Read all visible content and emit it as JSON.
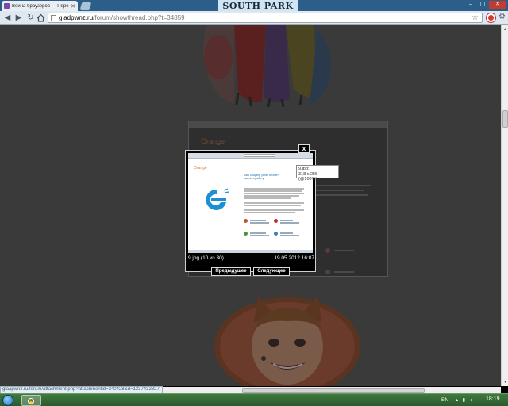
{
  "browser": {
    "tab_title": "Война браузеров — Пере",
    "tab_close": "✕",
    "banner": "SOUTH PARK",
    "window_buttons": {
      "minimize": "–",
      "maximize": "▢",
      "close": "✕"
    },
    "nav": {
      "back": "◀",
      "forward": "▶",
      "reload": "↻"
    },
    "url_domain": "gladpwnz.ru",
    "url_path": "/forum/showthread.php?t=34859",
    "star": "☆",
    "wrench": "⚙"
  },
  "lightbox": {
    "close_label": "x",
    "caption_left": "9.jpg (10 из 30)",
    "caption_right": "19.05.2012 16:07",
    "prev_label": "Предыдущее",
    "next_label": "Следующее",
    "tooltip_name": "9.jpg:",
    "tooltip_size": "318 x 255 (@100%)",
    "image": {
      "title": "Orange",
      "heading_line1": "Ваш браузер устал и хочет",
      "heading_line2": "сменить работу"
    }
  },
  "background": {
    "dim_title": "Orange"
  },
  "status": {
    "link": "glaapwnz.ru/forum/attachment.php?attachmentid=340428&d=1337432827"
  },
  "taskbar": {
    "lang": "EN",
    "tray": "▴ ▮ ◂",
    "clock": "18:19"
  },
  "colors": {
    "accent_orange": "#e77a2a",
    "ie_blue": "#1d8fd6",
    "overlay_dark": "#3a3a3a"
  }
}
